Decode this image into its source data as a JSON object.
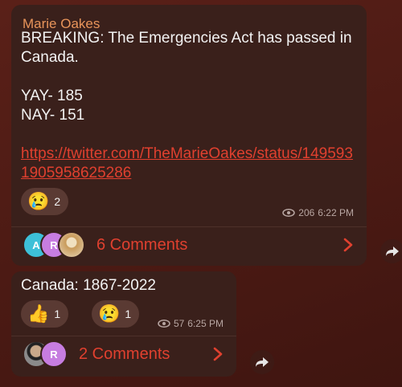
{
  "messages": [
    {
      "sender": "Marie Oakes",
      "lines": [
        "BREAKING: The Emergencies Act has passed in Canada.",
        "",
        "YAY- 185",
        "NAY- 151",
        ""
      ],
      "link": "https://twitter.com/TheMarieOakes/status/1495931905958625286",
      "reactions": [
        {
          "emoji": "😢",
          "count": "2"
        }
      ],
      "views": "206",
      "time": "6:22 PM",
      "comments": "6 Comments",
      "avatars": [
        {
          "initial": "A",
          "color": "#3dc0d8"
        },
        {
          "initial": "R",
          "color": "#c77de0"
        },
        {
          "initial": "",
          "color": "#d9b98a"
        }
      ]
    },
    {
      "text": "Canada: 1867-2022",
      "reactions": [
        {
          "emoji": "👍",
          "count": "1"
        },
        {
          "emoji": "😢",
          "count": "1"
        }
      ],
      "views": "57",
      "time": "6:25 PM",
      "comments": "2 Comments",
      "avatars": [
        {
          "initial": "",
          "color": "#555555"
        },
        {
          "initial": "R",
          "color": "#c77de0"
        }
      ]
    }
  ],
  "colors": {
    "accent": "#e0402f",
    "sender": "#e8945a",
    "bubble": "#3a201b"
  }
}
